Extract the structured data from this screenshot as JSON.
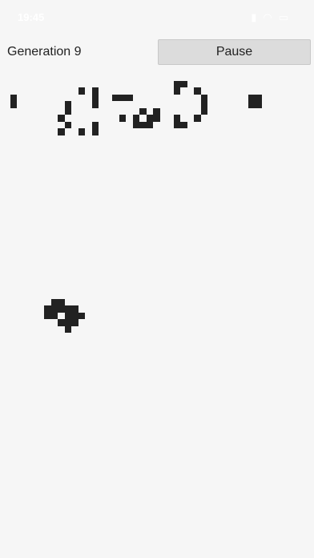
{
  "status_bar": {
    "time": "19:45",
    "icons": [
      "signal-icon",
      "wifi-icon",
      "battery-icon"
    ]
  },
  "header": {
    "generation_label": "Generation 9",
    "pause_label": "Pause"
  },
  "board": {
    "cell_color": "#222222",
    "background": "#f6f6f6",
    "live_cells": [
      [
        1,
        3
      ],
      [
        1,
        4
      ],
      [
        9,
        4
      ],
      [
        9,
        5
      ],
      [
        8,
        6
      ],
      [
        9,
        7
      ],
      [
        8,
        8
      ],
      [
        11,
        2
      ],
      [
        13,
        2
      ],
      [
        11,
        8
      ],
      [
        13,
        8
      ],
      [
        13,
        3
      ],
      [
        13,
        4
      ],
      [
        13,
        7
      ],
      [
        16,
        3
      ],
      [
        17,
        3
      ],
      [
        18,
        3
      ],
      [
        17,
        6
      ],
      [
        19,
        6
      ],
      [
        19,
        7
      ],
      [
        20,
        7
      ],
      [
        21,
        7
      ],
      [
        21,
        6
      ],
      [
        22,
        6
      ],
      [
        22,
        5
      ],
      [
        20,
        5
      ],
      [
        25,
        1
      ],
      [
        25,
        2
      ],
      [
        26,
        1
      ],
      [
        28,
        2
      ],
      [
        29,
        3
      ],
      [
        29,
        4
      ],
      [
        29,
        5
      ],
      [
        28,
        6
      ],
      [
        25,
        6
      ],
      [
        25,
        7
      ],
      [
        26,
        7
      ],
      [
        36,
        3
      ],
      [
        37,
        3
      ],
      [
        36,
        4
      ],
      [
        37,
        4
      ],
      [
        7,
        33
      ],
      [
        8,
        33
      ],
      [
        6,
        34
      ],
      [
        7,
        34
      ],
      [
        8,
        34
      ],
      [
        9,
        34
      ],
      [
        10,
        34
      ],
      [
        6,
        35
      ],
      [
        7,
        35
      ],
      [
        9,
        35
      ],
      [
        10,
        35
      ],
      [
        11,
        35
      ],
      [
        8,
        36
      ],
      [
        9,
        36
      ],
      [
        10,
        36
      ],
      [
        9,
        37
      ]
    ]
  }
}
